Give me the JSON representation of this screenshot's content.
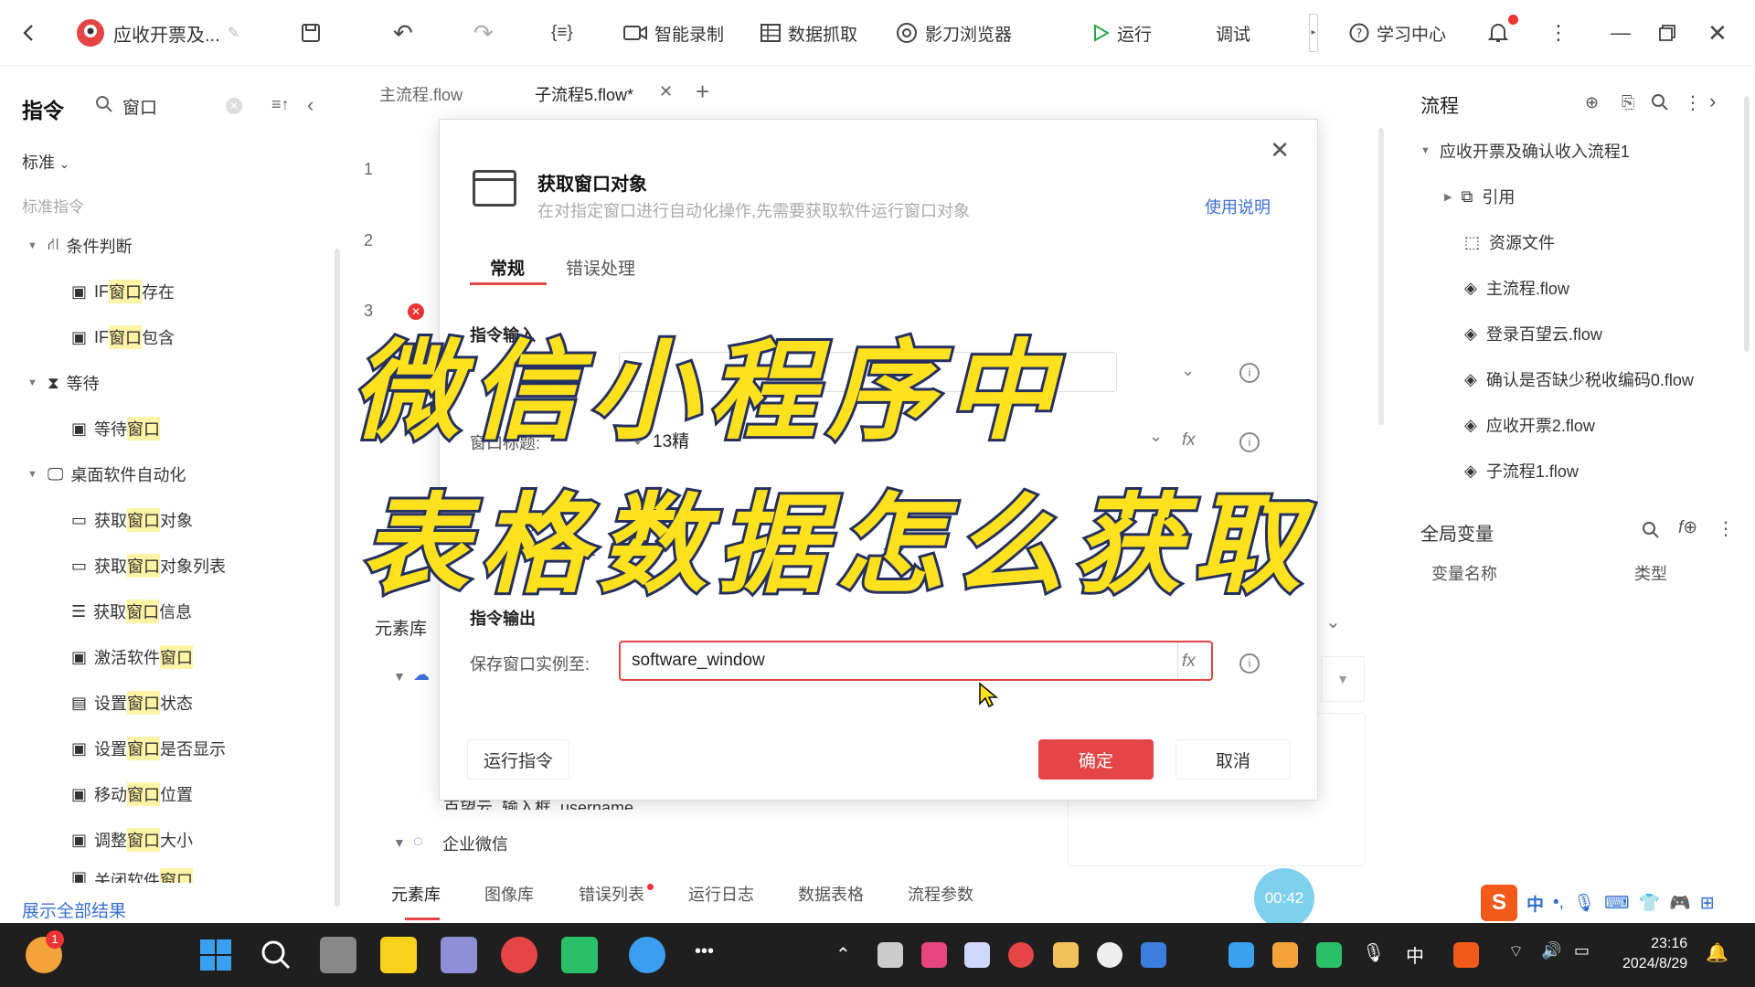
{
  "topbar": {
    "app_title": "应收开票及...",
    "record_label": "智能录制",
    "grab_label": "数据抓取",
    "browser_label": "影刀浏览器",
    "run_label": "运行",
    "debug_label": "调试",
    "learn_label": "学习中心"
  },
  "left": {
    "title": "指令",
    "search_value": "窗口",
    "standard_label": "标准",
    "standard_cmds_label": "标准指令",
    "show_all": "展示全部结果",
    "items": [
      {
        "pre": "条件判断",
        "hl": "",
        "post": ""
      },
      {
        "pre": "IF ",
        "hl": "窗口",
        "post": "存在"
      },
      {
        "pre": "IF ",
        "hl": "窗口",
        "post": "包含"
      },
      {
        "pre": "等待",
        "hl": "",
        "post": ""
      },
      {
        "pre": "等待",
        "hl": "窗口",
        "post": ""
      },
      {
        "pre": "桌面软件自动化",
        "hl": "",
        "post": ""
      },
      {
        "pre": "获取",
        "hl": "窗口",
        "post": "对象"
      },
      {
        "pre": "获取",
        "hl": "窗口",
        "post": "对象列表"
      },
      {
        "pre": "获取",
        "hl": "窗口",
        "post": "信息"
      },
      {
        "pre": "激活软件",
        "hl": "窗口",
        "post": ""
      },
      {
        "pre": "设置",
        "hl": "窗口",
        "post": "状态"
      },
      {
        "pre": "设置",
        "hl": "窗口",
        "post": "是否显示"
      },
      {
        "pre": "移动",
        "hl": "窗口",
        "post": "位置"
      },
      {
        "pre": "调整",
        "hl": "窗口",
        "post": "大小"
      },
      {
        "pre": "关闭软件",
        "hl": "窗口",
        "post": ""
      }
    ]
  },
  "center": {
    "tab1": "主流程.flow",
    "tab2": "子流程5.flow*",
    "lines": [
      "1",
      "2",
      "3"
    ],
    "elem_lib": "元素库",
    "tree_partial": "百望云_输入框_username",
    "tree_wecom": "企业微信",
    "bottom_tabs": [
      "元素库",
      "图像库",
      "错误列表",
      "运行日志",
      "数据表格",
      "流程参数"
    ]
  },
  "right": {
    "title": "流程",
    "root": "应收开票及确认收入流程1",
    "items": [
      "引用",
      "资源文件",
      "主流程.flow",
      "登录百望云.flow",
      "确认是否缺少税收编码0.flow",
      "应收开票2.flow",
      "子流程1.flow"
    ],
    "vars_title": "全局变量",
    "col_name": "变量名称",
    "col_type": "类型"
  },
  "dialog": {
    "title": "获取窗口对象",
    "desc": "在对指定窗口进行自动化操作,先需要获取软件运行窗口对象",
    "help": "使用说明",
    "tab_general": "常规",
    "tab_error": "错误处理",
    "input_section": "指令输入",
    "window_title_label": "窗口标题:",
    "window_title_value": "13精",
    "output_section": "指令输出",
    "save_label": "保存窗口实例至:",
    "save_value": "software_window",
    "run_btn": "运行指令",
    "ok_btn": "确定",
    "cancel_btn": "取消",
    "fx": "fx"
  },
  "overlay": {
    "line1": "微信小程序中",
    "line2": "表格数据怎么获取"
  },
  "recording_time": "00:42",
  "ime": {
    "lang": "中"
  },
  "taskbar": {
    "badge": "1",
    "lang": "中",
    "time": "23:16",
    "date": "2024/8/29"
  }
}
